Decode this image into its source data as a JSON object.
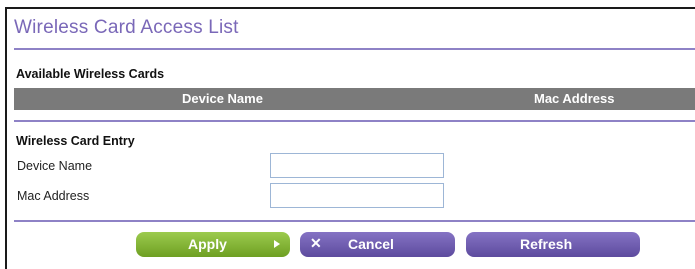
{
  "title": "Wireless Card Access List",
  "available": {
    "heading": "Available Wireless Cards",
    "columns": [
      "Device Name",
      "Mac Address"
    ],
    "rows": []
  },
  "entry": {
    "heading": "Wireless Card Entry",
    "device_name_label": "Device Name",
    "device_name_value": "",
    "mac_address_label": "Mac Address",
    "mac_address_value": ""
  },
  "buttons": {
    "apply": "Apply",
    "cancel": "Cancel",
    "refresh": "Refresh"
  },
  "icons": {
    "apply": "arrow-right-icon",
    "cancel": "x-icon"
  },
  "colors": {
    "title": "#7a68b8",
    "rule": "#8e82c6",
    "table_header": "#7a7a7a",
    "apply_button": "#82b43a",
    "purple_button": "#6f5cb0"
  }
}
